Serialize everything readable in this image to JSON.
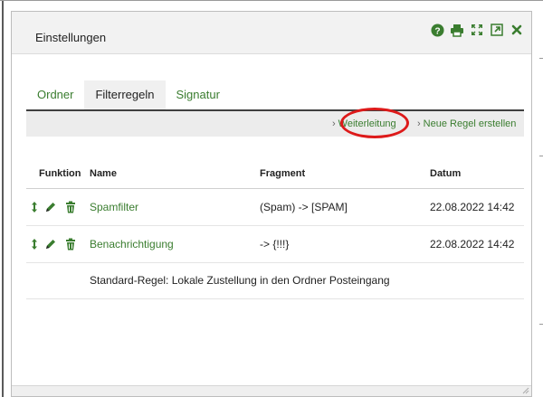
{
  "dialog": {
    "title": "Einstellungen",
    "header_icons": [
      "help-icon",
      "print-icon",
      "expand-icon",
      "open-external-icon",
      "close-icon"
    ],
    "accent_color": "#3a7d2f"
  },
  "tabs": [
    {
      "label": "Ordner",
      "active": false
    },
    {
      "label": "Filterregeln",
      "active": true
    },
    {
      "label": "Signatur",
      "active": false
    }
  ],
  "toolbar": {
    "forward_label": "Weiterleitung",
    "new_rule_label": "Neue Regel erstellen"
  },
  "table": {
    "columns": {
      "function": "Funktion",
      "name": "Name",
      "fragment": "Fragment",
      "date": "Datum"
    },
    "rows": [
      {
        "name": "Spamfilter",
        "fragment": "(Spam) -> [SPAM]",
        "date": "22.08.2022 14:42"
      },
      {
        "name": "Benachrichtigung",
        "fragment": "-> {!!!}",
        "date": "22.08.2022 14:42"
      }
    ],
    "default_rule": "Standard-Regel: Lokale Zustellung in den Ordner Posteingang"
  }
}
